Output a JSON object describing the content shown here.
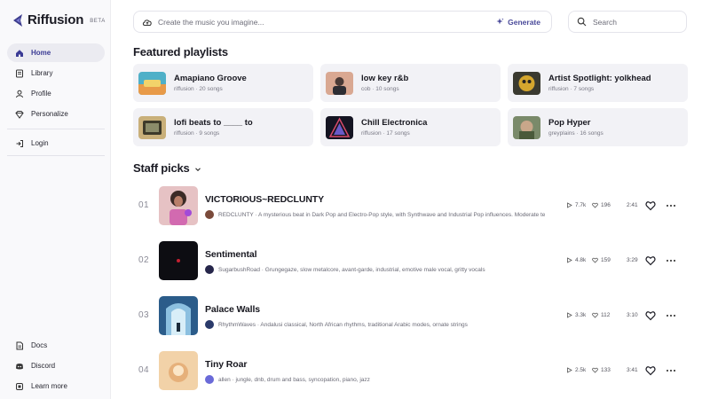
{
  "app": {
    "name": "Riffusion",
    "badge": "BETA"
  },
  "sidebar": {
    "main_items": [
      {
        "label": "Home",
        "icon": "home-icon",
        "active": true
      },
      {
        "label": "Library",
        "icon": "library-icon"
      },
      {
        "label": "Profile",
        "icon": "profile-icon"
      },
      {
        "label": "Personalize",
        "icon": "personalize-icon"
      }
    ],
    "login": {
      "label": "Login",
      "icon": "login-icon"
    },
    "bottom_items": [
      {
        "label": "Docs",
        "icon": "docs-icon"
      },
      {
        "label": "Discord",
        "icon": "discord-icon"
      },
      {
        "label": "Learn more",
        "icon": "learn-more-icon"
      }
    ]
  },
  "topbar": {
    "create_placeholder": "Create the music you imagine...",
    "generate_label": "Generate",
    "search_placeholder": "Search"
  },
  "featured": {
    "title": "Featured playlists",
    "playlists": [
      {
        "name": "Amapiano Groove",
        "meta": "riffusion · 20 songs"
      },
      {
        "name": "low key r&b",
        "meta": "cob · 10 songs"
      },
      {
        "name": "Artist Spotlight: yolkhead",
        "meta": "riffusion · 7 songs"
      },
      {
        "name": "lofi beats to ____ to",
        "meta": "riffusion · 9 songs"
      },
      {
        "name": "Chill Electronica",
        "meta": "riffusion · 17 songs"
      },
      {
        "name": "Pop Hyper",
        "meta": "greyplains · 16 songs"
      }
    ]
  },
  "staff_picks": {
    "title": "Staff picks",
    "tracks": [
      {
        "num": "01",
        "title": "VICTORIOUS~REDCLUNTY",
        "artist": "REDCLUNTY",
        "desc": "REDCLUNTY · A mysterious beat in Dark Pop and Electro-Pop style, with Synthwave and Industrial Pop influences. Moderate te",
        "plays": "7.7k",
        "likes": "196",
        "duration": "2:41"
      },
      {
        "num": "02",
        "title": "Sentimental",
        "artist": "SugarbushRoad",
        "desc": "SugarbushRoad · Grungegaze, slow metalcore, avant-garde, industrial, emotive male vocal, gritty vocals",
        "plays": "4.8k",
        "likes": "159",
        "duration": "3:29"
      },
      {
        "num": "03",
        "title": "Palace Walls",
        "artist": "RhythmWaves",
        "desc": "RhythmWaves · Andalusi classical, North African rhythms, traditional Arabic modes, ornate strings",
        "plays": "3.3k",
        "likes": "112",
        "duration": "3:10"
      },
      {
        "num": "04",
        "title": "Tiny Roar",
        "artist": "allen",
        "desc": "allen · jungle, dnb, drum and bass, syncopation, piano, jazz",
        "plays": "2.5k",
        "likes": "133",
        "duration": "3:41"
      }
    ]
  }
}
